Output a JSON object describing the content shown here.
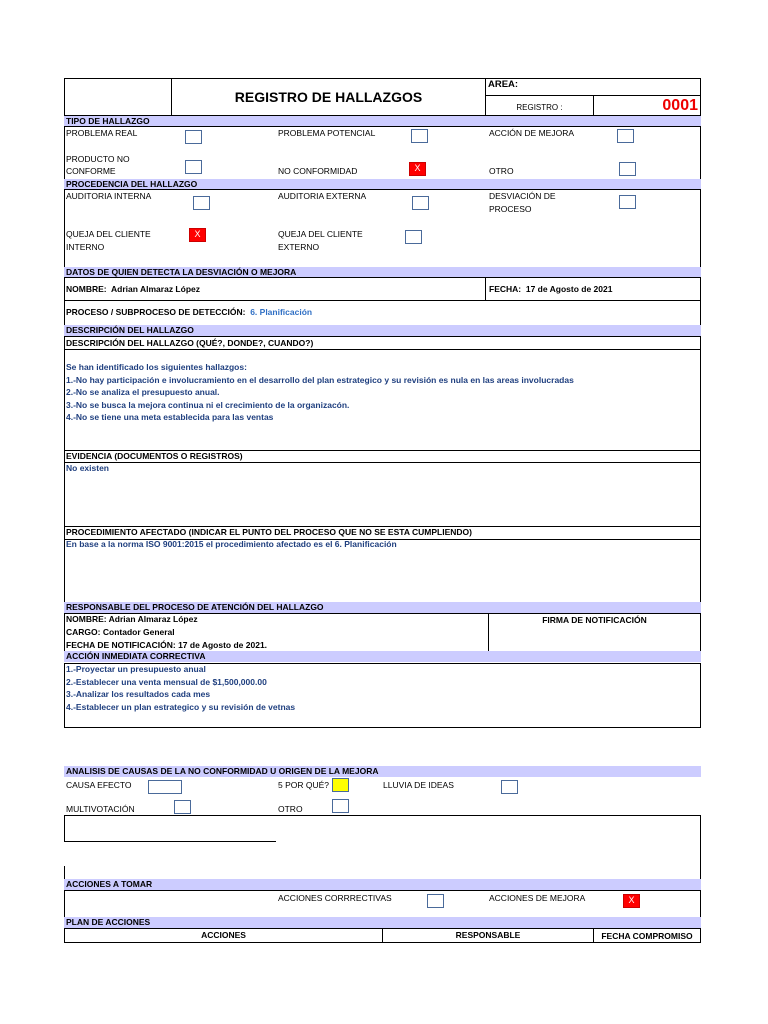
{
  "header": {
    "title": "REGISTRO DE HALLAZGOS",
    "area_label": "AREA:",
    "registro_label": "REGISTRO :",
    "registro_value": "0001"
  },
  "tipo": {
    "title": "TIPO DE HALLAZGO",
    "items": [
      {
        "label": "PROBLEMA REAL",
        "checked": ""
      },
      {
        "label": "PROBLEMA POTENCIAL",
        "checked": ""
      },
      {
        "label": "ACCIÓN DE MEJORA",
        "checked": ""
      },
      {
        "label": "PRODUCTO NO",
        "label2": "CONFORME",
        "checked": ""
      },
      {
        "label": "NO CONFORMIDAD",
        "checked": "X"
      },
      {
        "label": "OTRO",
        "checked": ""
      }
    ]
  },
  "procedencia": {
    "title": "PROCEDENCIA DEL HALLAZGO",
    "items": [
      {
        "label": "AUDITORIA INTERNA",
        "checked": ""
      },
      {
        "label": "AUDITORIA EXTERNA",
        "checked": ""
      },
      {
        "label": "DESVIACIÓN DE",
        "label2": "PROCESO",
        "checked": ""
      },
      {
        "label": "QUEJA DEL CLIENTE",
        "label2": "INTERNO",
        "checked": "X"
      },
      {
        "label": "QUEJA DEL CLIENTE",
        "label2": "EXTERNO",
        "checked": ""
      }
    ]
  },
  "datos": {
    "title": "DATOS DE QUIEN DETECTA LA DESVIACIÓN O MEJORA",
    "nombre_label": "NOMBRE:",
    "nombre": "Adrian Almaraz López",
    "fecha_label": "FECHA:",
    "fecha": "17 de Agosto de 2021",
    "proceso_label": "PROCESO / SUBPROCESO DE DETECCIÓN:",
    "proceso": "6. Planificación"
  },
  "descripcion": {
    "title": "DESCRIPCIÓN DEL HALLAZGO",
    "subtitle": "DESCRIPCIÓN DEL HALLAZGO (QUÉ?, DONDE?, CUANDO?)",
    "lines": [
      "Se han identificado los siguientes hallazgos:",
      "1.-No hay participación e involucramiento en el desarrollo del plan estrategico y su revisión es nula en las areas involucradas",
      "2.-No se analiza el presupuesto anual.",
      "3.-No se busca la mejora continua ni el crecimiento de la organizacón.",
      "4.-No se tiene una meta establecida para las ventas"
    ]
  },
  "evidencia": {
    "title": "EVIDENCIA (DOCUMENTOS O REGISTROS)",
    "text": "No existen"
  },
  "procedimiento": {
    "title": "PROCEDIMIENTO AFECTADO (INDICAR EL PUNTO DEL PROCESO QUE NO SE ESTA CUMPLIENDO)",
    "text": "En base a la norma ISO 9001:2015 el procedimiento afectado es el 6. Planificación"
  },
  "responsable": {
    "title": "RESPONSABLE DEL PROCESO DE ATENCIÓN DEL HALLAZGO",
    "nombre": "NOMBRE: Adrian Almaraz López",
    "cargo_label": "CARGO:",
    "cargo": "Contador General",
    "fecha": "FECHA DE NOTIFICACIÓN: 17 de Agosto de 2021.",
    "firma": "FIRMA DE NOTIFICACIÓN"
  },
  "accion_inmediata": {
    "title": "ACCIÓN INMEDIATA CORRECTIVA",
    "lines": [
      "1.-Proyectar un presupuesto anual",
      "2.-Establecer una venta mensual de $1,500,000.00",
      "3.-Analizar los resultados cada mes",
      "4.-Establecer un plan estrategico y su revisión de vetnas"
    ]
  },
  "analisis": {
    "title": "ANALISIS DE CAUSAS DE LA NO CONFORMIDAD U ORIGEN DE LA MEJORA",
    "items": [
      {
        "label": "CAUSA EFECTO",
        "checked": ""
      },
      {
        "label": "5 POR QUÉ?",
        "checked": "yes"
      },
      {
        "label": "LLUVIA DE IDEAS",
        "checked": ""
      },
      {
        "label": "MULTIVOTACIÓN",
        "checked": ""
      },
      {
        "label": "OTRO",
        "checked": ""
      }
    ]
  },
  "acciones": {
    "title": "ACCIONES A TOMAR",
    "correctivas": "ACCIONES CORRRECTIVAS",
    "mejora": "ACCIONES DE MEJORA",
    "correctivas_checked": "",
    "mejora_checked": "X"
  },
  "plan": {
    "title": "PLAN DE ACCIONES",
    "columns": [
      "ACCIONES",
      "RESPONSABLE",
      "FECHA COMPROMISO"
    ]
  }
}
